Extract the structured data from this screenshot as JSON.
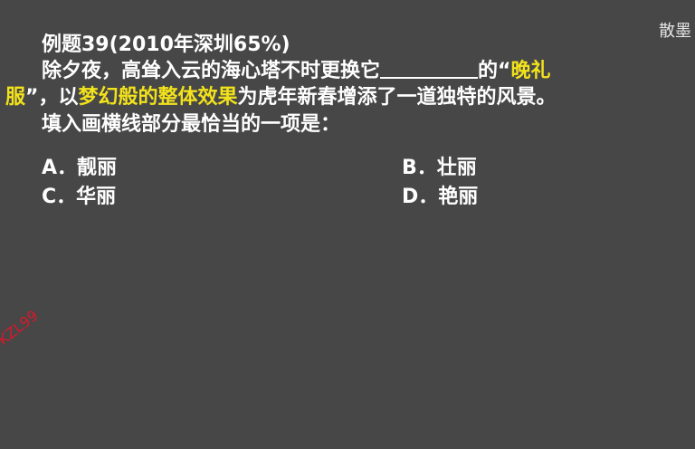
{
  "corner_mark": "散墨",
  "title": "例题39(2010年深圳65%)",
  "question": {
    "line1_a": "除夕夜，高耸入云的海心塔不时更换它",
    "line1_b": "的“",
    "line1_hl": "晚礼",
    "line2_hl1": "服",
    "line2_a": "”，以",
    "line2_hl2": "梦幻般的整体效果",
    "line2_b": "为虎年新春增添了一道独特的风景。",
    "line3": "填入画横线部分最恰当的一项是："
  },
  "options": [
    {
      "label": "A．靓丽"
    },
    {
      "label": "B．壮丽"
    },
    {
      "label": "C．华丽"
    },
    {
      "label": "D．艳丽"
    }
  ],
  "stamp_text": "KZL99",
  "colors": {
    "background": "#474747",
    "text": "#ffffff",
    "highlight": "#f2e21c",
    "stamp": "#d8182a"
  }
}
